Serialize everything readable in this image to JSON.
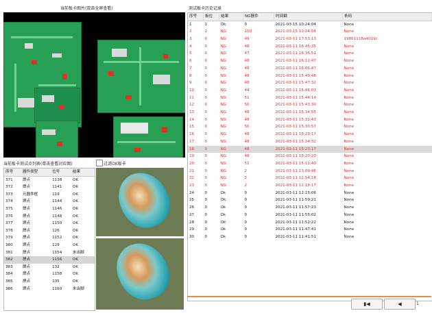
{
  "board_panel": {
    "title": "当前板卡图片(双击全屏查看)"
  },
  "history_panel": {
    "title": "测试板卡历史记录"
  },
  "points_panel": {
    "title": "当前板卡测试点列表(单击查看对应图)"
  },
  "filter": {
    "label": "过滤OK板卡",
    "checked": false
  },
  "points": {
    "columns": [
      "序号",
      "器件类型",
      "位号",
      "结果"
    ],
    "rows": [
      [
        "371",
        "焊点",
        "1138",
        "OK"
      ],
      [
        "372",
        "焊点",
        "1141",
        "OK"
      ],
      [
        "373",
        "元器件框",
        "119",
        "OK"
      ],
      [
        "374",
        "焊点",
        "1144",
        "OK"
      ],
      [
        "375",
        "焊点",
        "1146",
        "OK"
      ],
      [
        "376",
        "焊点",
        "1148",
        "OK"
      ],
      [
        "377",
        "焊点",
        "1150",
        "OK"
      ],
      [
        "378",
        "焊点",
        "126",
        "OK"
      ],
      [
        "379",
        "焊点",
        "1152",
        "OK"
      ],
      [
        "380",
        "焊点",
        "129",
        "OK"
      ],
      [
        "381",
        "焊点",
        "1154",
        "未出脚"
      ],
      [
        "382",
        "焊点",
        "1156",
        "OK"
      ],
      [
        "383",
        "焊点",
        "132",
        "OK"
      ],
      [
        "384",
        "焊点",
        "1158",
        "OK"
      ],
      [
        "385",
        "焊点",
        "135",
        "OK"
      ],
      [
        "386",
        "焊点",
        "1160",
        "未出脚"
      ]
    ],
    "selected_index": 11
  },
  "history": {
    "columns": [
      "序号",
      "板位",
      "结果",
      "NG器件",
      "时间戳",
      "条码"
    ],
    "rows": [
      [
        "1",
        "1",
        "Ok",
        "0",
        "2021-03-15 10:24:04",
        "None"
      ],
      [
        "2",
        "2",
        "NG",
        "150",
        "2021-03-15 10:24:04",
        "None"
      ],
      [
        "3",
        "0",
        "NG",
        "49",
        "2021-03-11 17:53:13",
        "19861118a4019c"
      ],
      [
        "4",
        "0",
        "NG",
        "48",
        "2021-03-11 16:45:35",
        "None"
      ],
      [
        "5",
        "0",
        "NG",
        "47",
        "2021-03-11 16:36:51",
        "None"
      ],
      [
        "6",
        "0",
        "NG",
        "48",
        "2021-03-11 16:11:47",
        "None"
      ],
      [
        "7",
        "0",
        "NG",
        "48",
        "2021-03-11 16:06:47",
        "None"
      ],
      [
        "8",
        "0",
        "NG",
        "48",
        "2021-03-11 15:49:48",
        "None"
      ],
      [
        "9",
        "0",
        "NG",
        "48",
        "2021-03-11 15:47:32",
        "None"
      ],
      [
        "10",
        "0",
        "NG",
        "44",
        "2021-03-11 15:46:03",
        "None"
      ],
      [
        "11",
        "0",
        "NG",
        "51",
        "2021-03-11 15:44:14",
        "None"
      ],
      [
        "12",
        "0",
        "NG",
        "50",
        "2021-03-11 15:43:30",
        "None"
      ],
      [
        "13",
        "0",
        "NG",
        "48",
        "2021-03-11 15:34:55",
        "None"
      ],
      [
        "14",
        "0",
        "NG",
        "48",
        "2021-03-11 15:32:43",
        "None"
      ],
      [
        "15",
        "0",
        "NG",
        "50",
        "2021-03-11 15:30:57",
        "None"
      ],
      [
        "16",
        "0",
        "NG",
        "48",
        "2021-03-11 15:29:17",
        "None"
      ],
      [
        "17",
        "0",
        "NG",
        "48",
        "2021-03-11 15:24:32",
        "None"
      ],
      [
        "18",
        "0",
        "NG",
        "48",
        "2021-03-11 15:23:17",
        "None"
      ],
      [
        "19",
        "0",
        "NG",
        "48",
        "2021-03-11 15:20:20",
        "None"
      ],
      [
        "20",
        "0",
        "NG",
        "51",
        "2021-03-11 15:12:40",
        "None"
      ],
      [
        "21",
        "0",
        "NG",
        "2",
        "2021-03-11 13:09:46",
        "None"
      ],
      [
        "22",
        "0",
        "NG",
        "2",
        "2021-03-11 12:54:18",
        "None"
      ],
      [
        "23",
        "0",
        "NG",
        "2",
        "2021-03-11 12:18:17",
        "None"
      ],
      [
        "24",
        "0",
        "Ok",
        "0",
        "2021-03-11 12:15:06",
        "None"
      ],
      [
        "25",
        "0",
        "Ok",
        "0",
        "2021-03-11 11:59:21",
        "None"
      ],
      [
        "26",
        "0",
        "Ok",
        "0",
        "2021-03-11 11:57:23",
        "None"
      ],
      [
        "27",
        "0",
        "Ok",
        "0",
        "2021-03-11 11:55:02",
        "None"
      ],
      [
        "28",
        "0",
        "Ok",
        "0",
        "2021-03-11 11:52:22",
        "None"
      ],
      [
        "29",
        "0",
        "Ok",
        "0",
        "2021-03-11 11:47:41",
        "None"
      ],
      [
        "30",
        "0",
        "Ok",
        "0",
        "2021-03-11 11:41:51",
        "None"
      ]
    ],
    "selected_index": 17
  },
  "pager": {
    "first_icon": "skip-to-start-icon",
    "prev_icon": "previous-page-icon",
    "page_text": "1"
  },
  "colors": {
    "ng": "#e0302a",
    "accent": "#f08a3c",
    "pcb": "#27a055"
  }
}
